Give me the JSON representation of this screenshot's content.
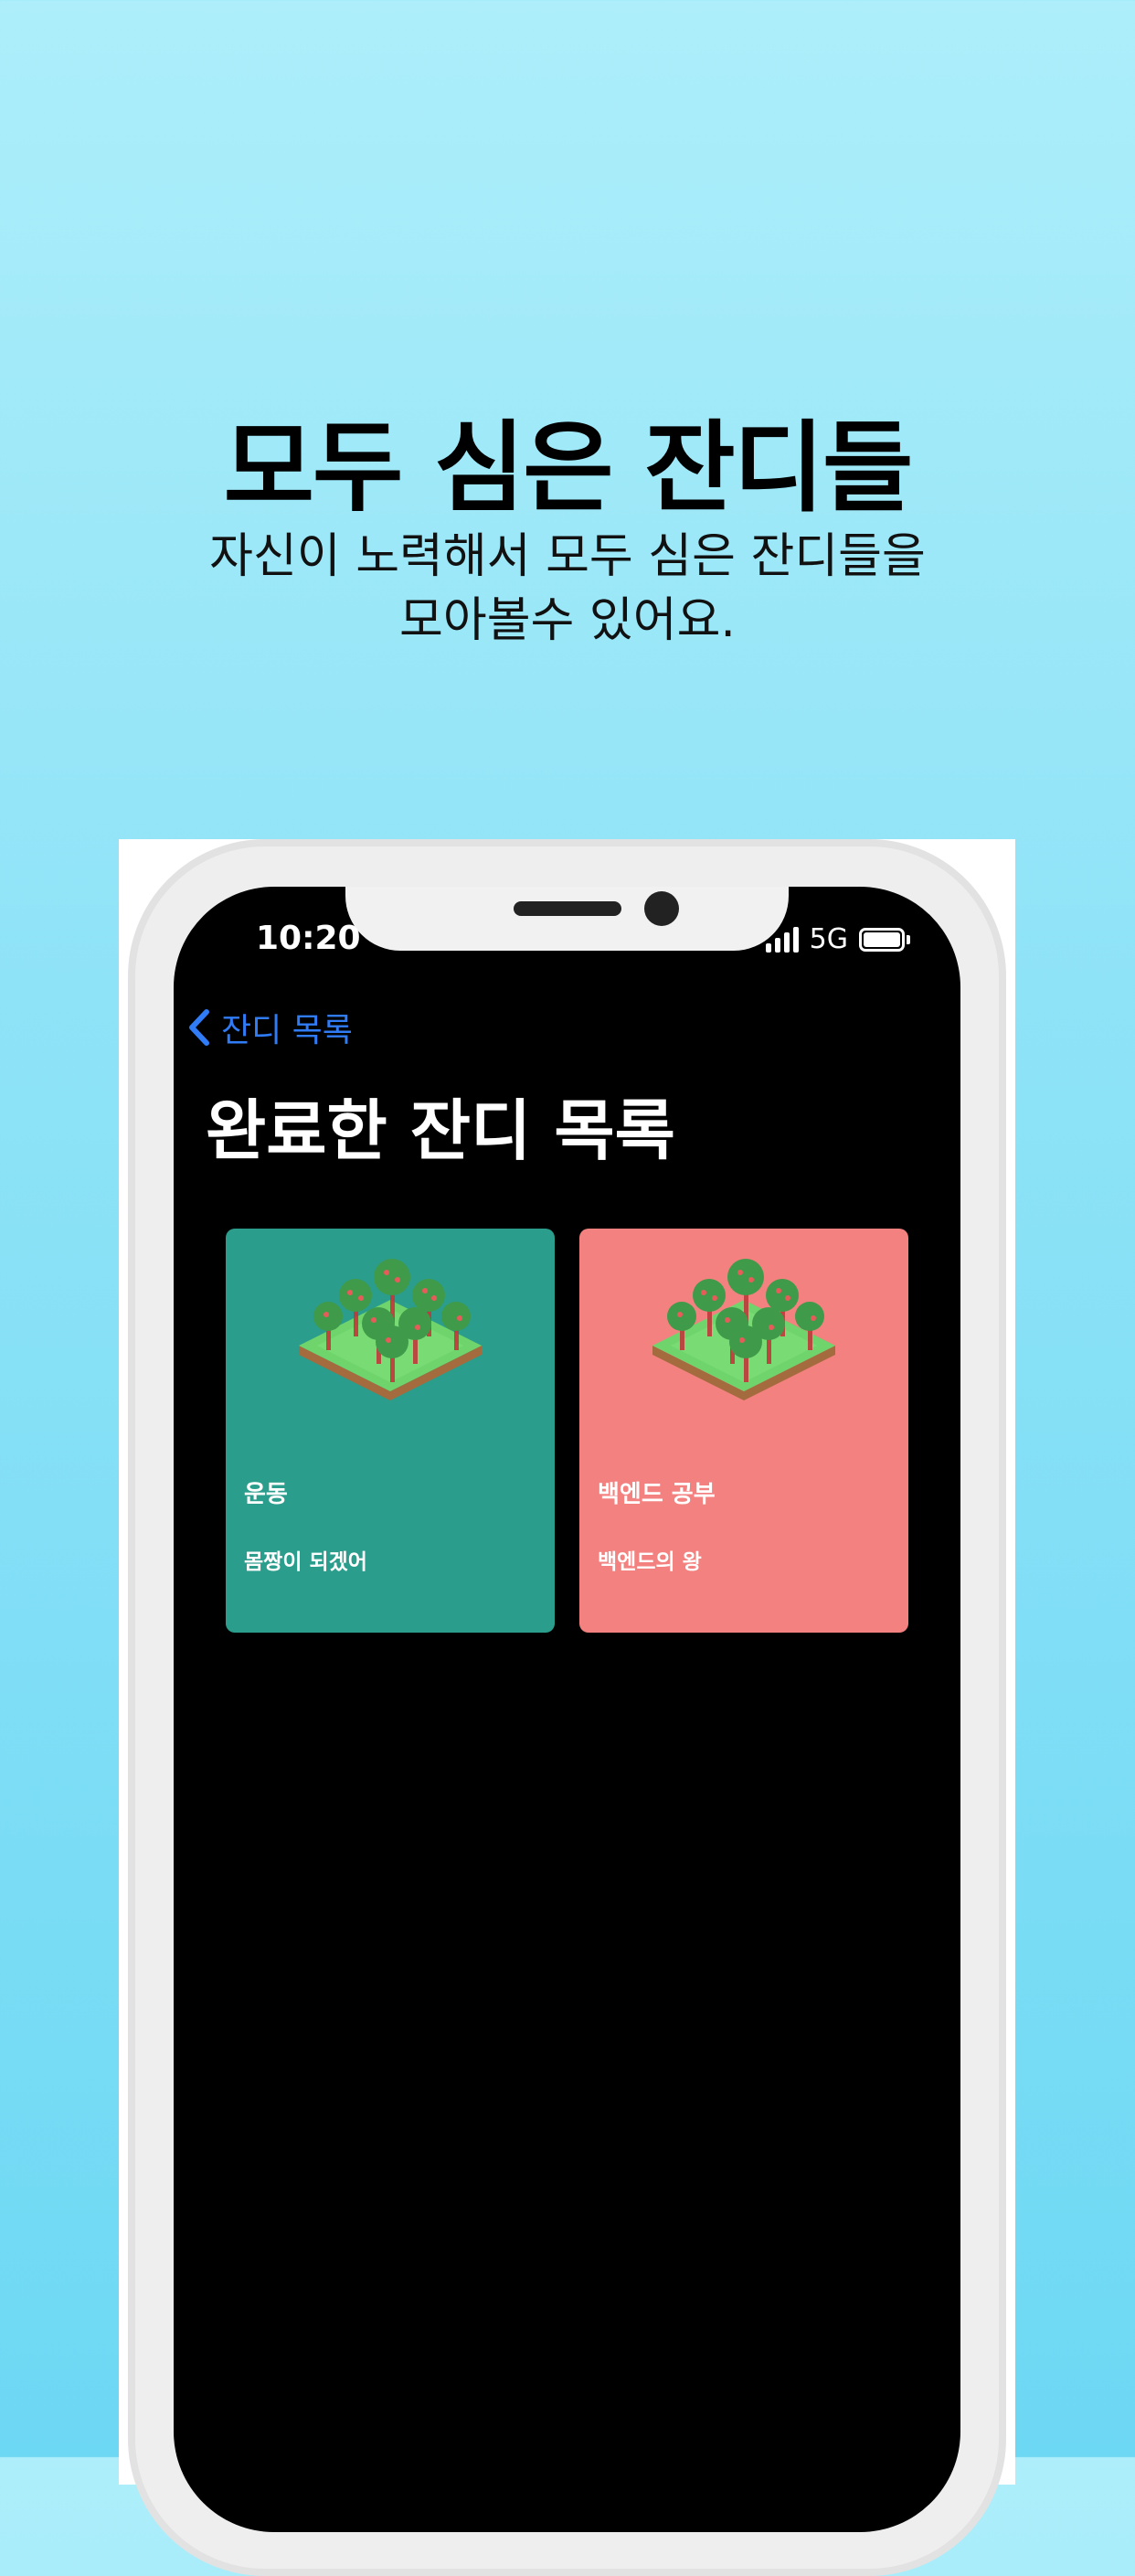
{
  "promo": {
    "title": "모두 심은 잔디들",
    "subtitle_line1": "자신이 노력해서 모두 심은 잔디들을",
    "subtitle_line2": "모아볼수 있어요."
  },
  "status_bar": {
    "time": "10:20",
    "network": "5G",
    "icons": [
      "signal-bars-icon",
      "battery-icon"
    ]
  },
  "nav": {
    "back_label": "잔디 목록",
    "back_icon": "chevron-left-icon"
  },
  "screen": {
    "title": "완료한 잔디 목록"
  },
  "cards": [
    {
      "title": "운동",
      "subtitle": "몸짱이 되겠어",
      "color": "#2a9d8c",
      "illustration": "isometric-tree-garden-icon"
    },
    {
      "title": "백엔드 공부",
      "subtitle": "백엔드의 왕",
      "color": "#f2817f",
      "illustration": "isometric-tree-garden-icon"
    }
  ],
  "colors": {
    "background_top": "#adeefa",
    "background_bottom": "#6dd8f4",
    "accent_link": "#2f7cf6",
    "screen_bg": "#000000"
  }
}
